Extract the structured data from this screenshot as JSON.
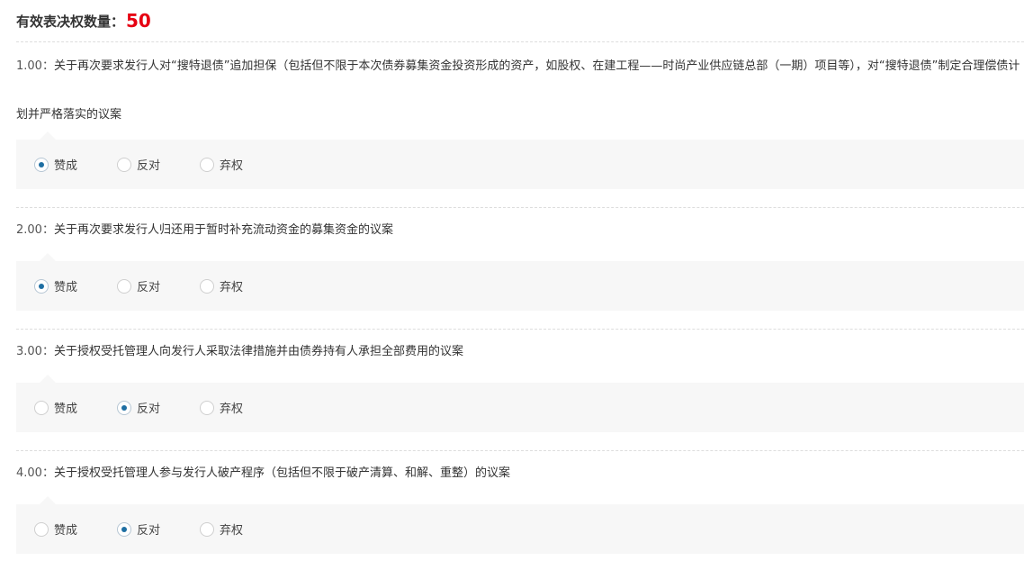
{
  "header": {
    "label": "有效表决权数量：",
    "count": "50"
  },
  "motions": [
    {
      "number": "1.00：",
      "text": "关于再次要求发行人对“搜特退债”追加担保（包括但不限于本次债券募集资金投资形成的资产，如股权、在建工程——时尚产业供应链总部（一期）项目等），对“搜特退债”制定合理偿债计划并严格落实的议案",
      "options": [
        "赞成",
        "反对",
        "弃权"
      ],
      "selected": "赞成"
    },
    {
      "number": "2.00：",
      "text": "关于再次要求发行人归还用于暂时补充流动资金的募集资金的议案",
      "options": [
        "赞成",
        "反对",
        "弃权"
      ],
      "selected": "赞成"
    },
    {
      "number": "3.00：",
      "text": "关于授权受托管理人向发行人采取法律措施并由债券持有人承担全部费用的议案",
      "options": [
        "赞成",
        "反对",
        "弃权"
      ],
      "selected": "反对"
    },
    {
      "number": "4.00：",
      "text": "关于授权受托管理人参与发行人破产程序（包括但不限于破产清算、和解、重整）的议案",
      "options": [
        "赞成",
        "反对",
        "弃权"
      ],
      "selected": "反对"
    }
  ],
  "colors": {
    "accent_red": "#e60012",
    "radio_dot": "#1f6fa3",
    "panel_bg": "#f7f7f7"
  }
}
